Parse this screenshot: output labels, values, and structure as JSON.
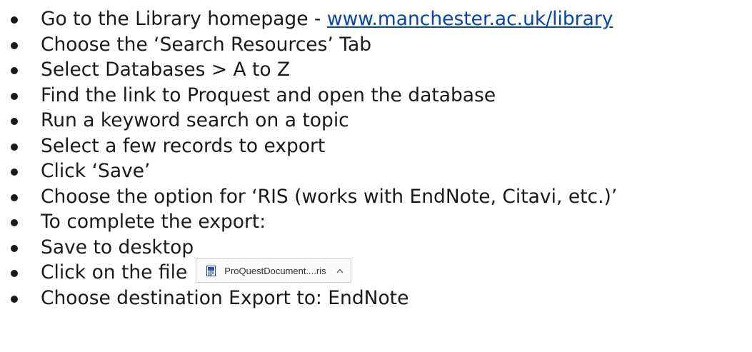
{
  "steps": [
    {
      "text": "Go to the Library homepage - ",
      "link": "www.manchester.ac.uk/library"
    },
    {
      "text": "Choose the ‘Search Resources’ Tab"
    },
    {
      "text": "Select Databases > A to Z"
    },
    {
      "text": "Find the link to Proquest and open the database"
    },
    {
      "text": "Run a keyword search on a topic"
    },
    {
      "text": "Select a few records to export"
    },
    {
      "text": "Click ‘Save’"
    },
    {
      "text": "Choose the option for ‘RIS (works with EndNote, Citavi, etc.)’"
    },
    {
      "text": "To complete the export:"
    },
    {
      "text": "Save to desktop"
    },
    {
      "text": "Click on the file",
      "file": {
        "name": "ProQuestDocument....ris",
        "icon": "document-icon",
        "chevron": "chevron-up-icon"
      }
    },
    {
      "text": "Choose destination Export to: EndNote"
    }
  ],
  "colors": {
    "text": "#1a1a1a",
    "link": "#0645ad"
  }
}
